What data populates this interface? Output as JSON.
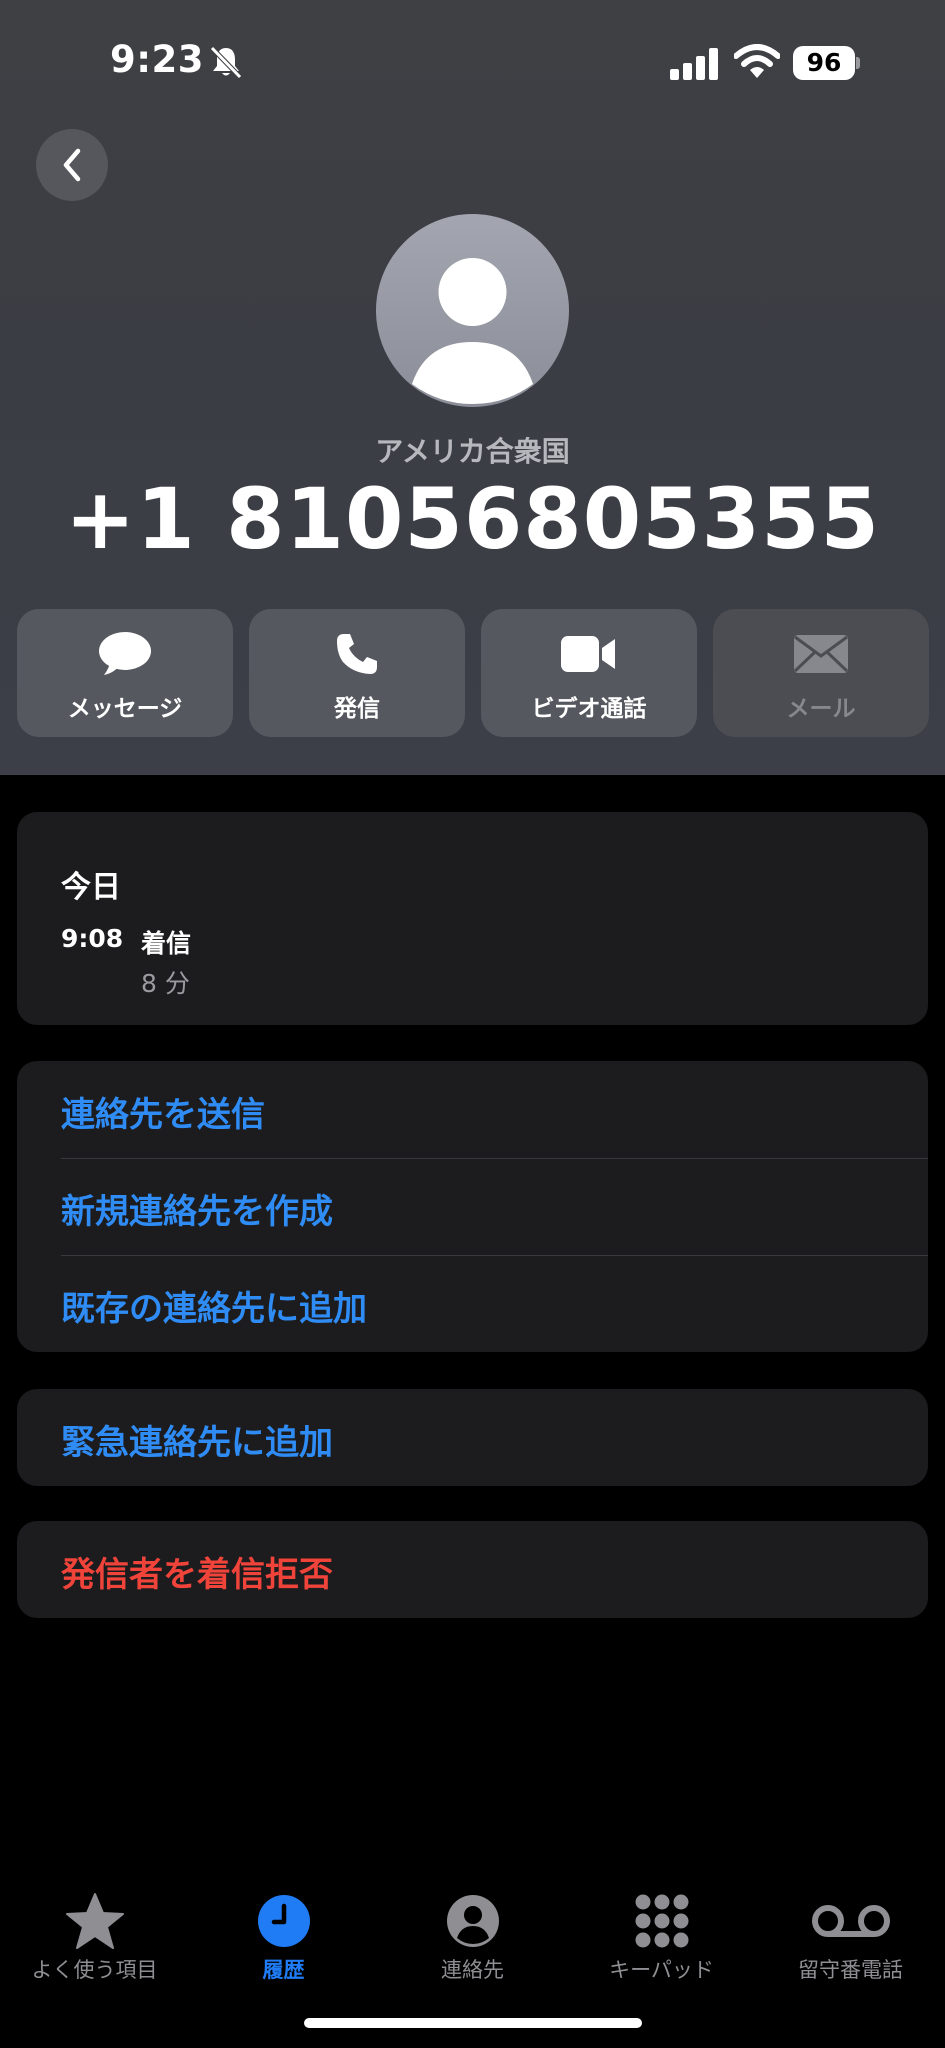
{
  "status_bar": {
    "time": "9:23",
    "battery": "96"
  },
  "contact": {
    "country": "アメリカ合衆国",
    "phone": "+1 81056805355"
  },
  "actions": [
    {
      "label": "メッセージ",
      "icon": "message-bubble-icon",
      "enabled": true
    },
    {
      "label": "発信",
      "icon": "phone-icon",
      "enabled": true
    },
    {
      "label": "ビデオ通話",
      "icon": "video-camera-icon",
      "enabled": true
    },
    {
      "label": "メール",
      "icon": "envelope-icon",
      "enabled": false
    }
  ],
  "history": {
    "day": "今日",
    "time": "9:08",
    "type": "着信",
    "duration": "8 分"
  },
  "options": {
    "share_contact": "連絡先を送信",
    "create_contact": "新規連絡先を作成",
    "add_existing": "既存の連絡先に追加",
    "add_emergency": "緊急連絡先に追加",
    "block_caller": "発信者を着信拒否"
  },
  "tabs": [
    {
      "label": "よく使う項目",
      "icon": "star-icon",
      "active": false
    },
    {
      "label": "履歴",
      "icon": "clock-icon",
      "active": true
    },
    {
      "label": "連絡先",
      "icon": "person-circle-icon",
      "active": false
    },
    {
      "label": "キーパッド",
      "icon": "keypad-icon",
      "active": false
    },
    {
      "label": "留守番電話",
      "icon": "voicemail-icon",
      "active": false
    }
  ],
  "colors": {
    "link_blue": "#2f8cf5",
    "destructive_red": "#f0443b",
    "active_tab": "#1f7cf5"
  }
}
